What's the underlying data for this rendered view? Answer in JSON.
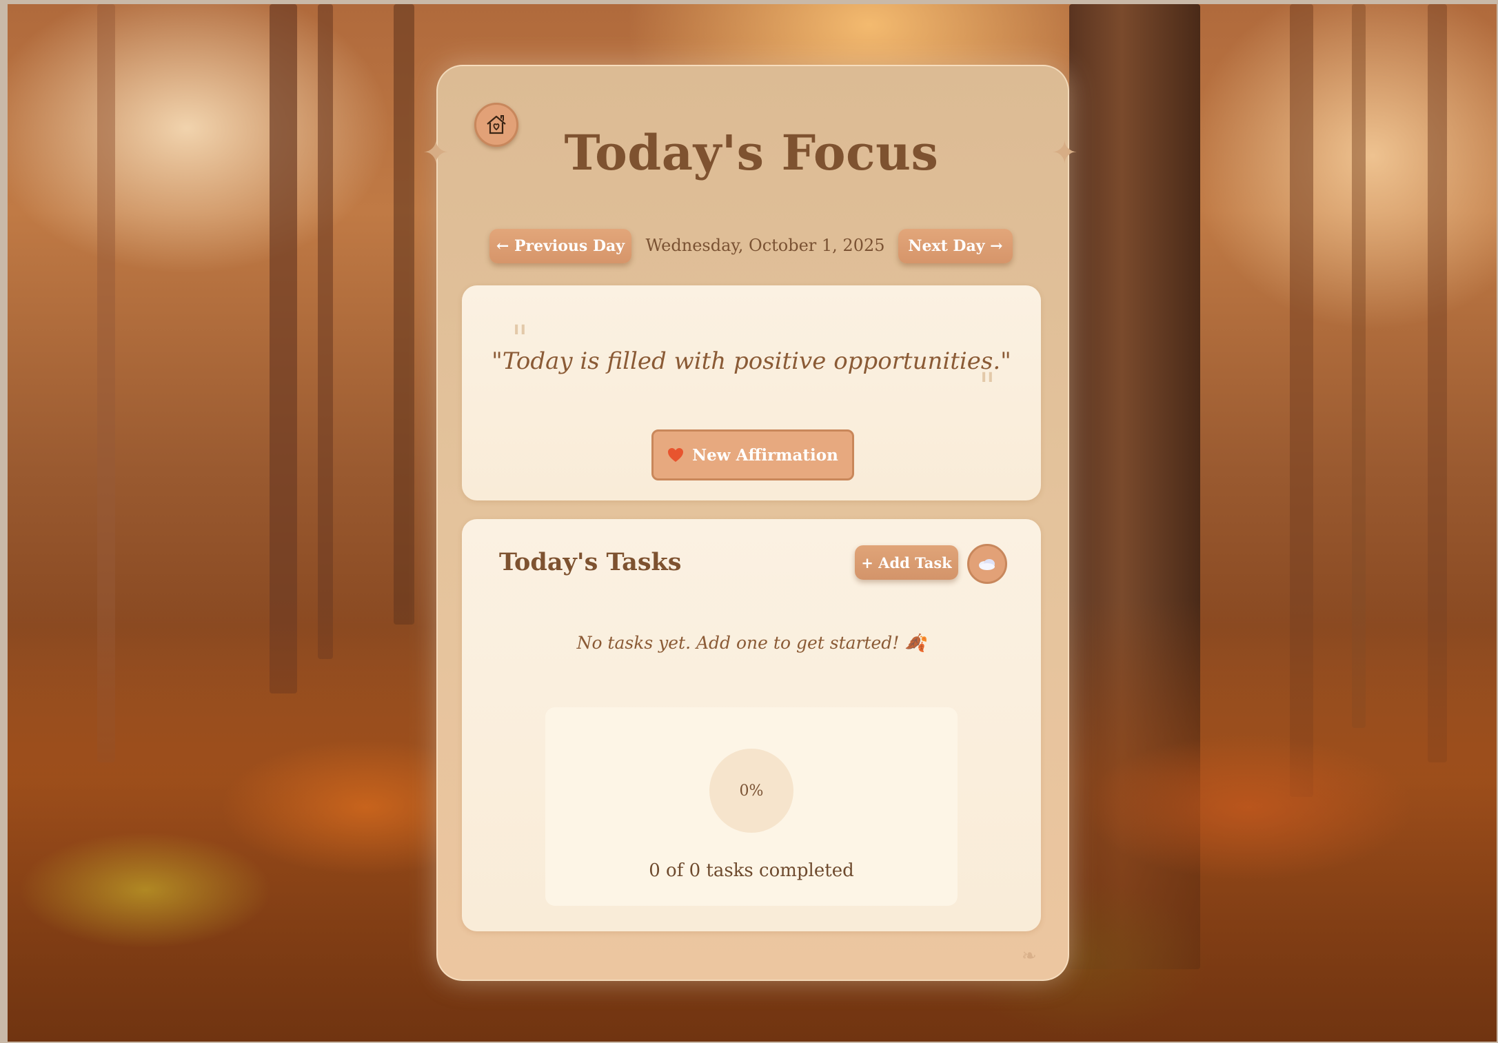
{
  "page": {
    "title": "Today's Focus",
    "date": "Wednesday, October 1, 2025"
  },
  "nav": {
    "home_icon": "home-heart-icon",
    "prev_label": "← Previous Day",
    "next_label": "Next Day →"
  },
  "affirmation": {
    "quote": "\"Today is filled with positive opportunities.\"",
    "open_mark": "\"",
    "close_mark": "\"",
    "button_icon": "heart-icon",
    "button_label": "New Affirmation"
  },
  "tasks": {
    "title": "Today's Tasks",
    "add_label": "+ Add Task",
    "theme_icon": "cloud-icon",
    "empty_message": "No tasks yet. Add one to get started! 🍂",
    "progress_percent": "0%",
    "progress_fraction": 0,
    "progress_text": "0 of 0 tasks completed"
  },
  "colors": {
    "accent": "#e2a177",
    "accent_border": "#c8875c",
    "title_text": "#7e5230",
    "panel_bg": "#fbf1e2"
  }
}
